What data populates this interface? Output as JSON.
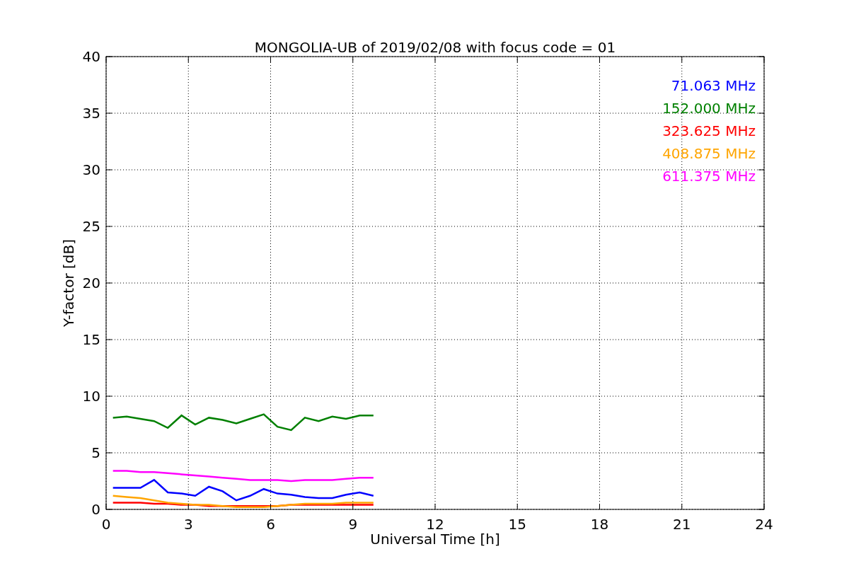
{
  "chart_data": {
    "type": "line",
    "title": "MONGOLIA-UB of 2019/02/08 with focus code = 01",
    "xlabel": "Universal Time [h]",
    "ylabel": "Y-factor [dB]",
    "x": [
      0.25,
      0.75,
      1.25,
      1.75,
      2.25,
      2.75,
      3.25,
      3.75,
      4.25,
      4.75,
      5.25,
      5.75,
      6.25,
      6.75,
      7.25,
      7.75,
      8.25,
      8.75,
      9.25,
      9.75
    ],
    "series": [
      {
        "name": "71.063 MHz",
        "color": "#0000ff",
        "values": [
          1.9,
          1.9,
          1.9,
          2.6,
          1.5,
          1.4,
          1.2,
          2.0,
          1.6,
          0.8,
          1.2,
          1.8,
          1.4,
          1.3,
          1.1,
          1.0,
          1.0,
          1.3,
          1.5,
          1.2
        ]
      },
      {
        "name": "152.000 MHz",
        "color": "#008000",
        "values": [
          8.1,
          8.2,
          8.0,
          7.8,
          7.2,
          8.3,
          7.5,
          8.1,
          7.9,
          7.6,
          8.0,
          8.4,
          7.3,
          7.0,
          8.1,
          7.8,
          8.2,
          8.0,
          8.3,
          8.3
        ]
      },
      {
        "name": "323.625 MHz",
        "color": "#ff0000",
        "values": [
          0.6,
          0.6,
          0.6,
          0.5,
          0.5,
          0.4,
          0.4,
          0.3,
          0.3,
          0.3,
          0.3,
          0.3,
          0.3,
          0.4,
          0.4,
          0.4,
          0.4,
          0.4,
          0.4,
          0.4
        ]
      },
      {
        "name": "408.875 MHz",
        "color": "#ffa500",
        "values": [
          1.2,
          1.1,
          1.0,
          0.8,
          0.6,
          0.5,
          0.4,
          0.4,
          0.3,
          0.2,
          0.2,
          0.2,
          0.3,
          0.4,
          0.5,
          0.5,
          0.5,
          0.6,
          0.6,
          0.6
        ]
      },
      {
        "name": "611.375 MHz",
        "color": "#ff00ff",
        "values": [
          3.4,
          3.4,
          3.3,
          3.3,
          3.2,
          3.1,
          3.0,
          2.9,
          2.8,
          2.7,
          2.6,
          2.6,
          2.6,
          2.5,
          2.6,
          2.6,
          2.6,
          2.7,
          2.8,
          2.8
        ]
      }
    ],
    "grid": true,
    "xlim": [
      0,
      24
    ],
    "ylim": [
      0,
      40
    ],
    "xticks": [
      0,
      3,
      6,
      9,
      12,
      15,
      18,
      21,
      24
    ],
    "yticks": [
      0,
      5,
      10,
      15,
      20,
      25,
      30,
      35,
      40
    ]
  }
}
